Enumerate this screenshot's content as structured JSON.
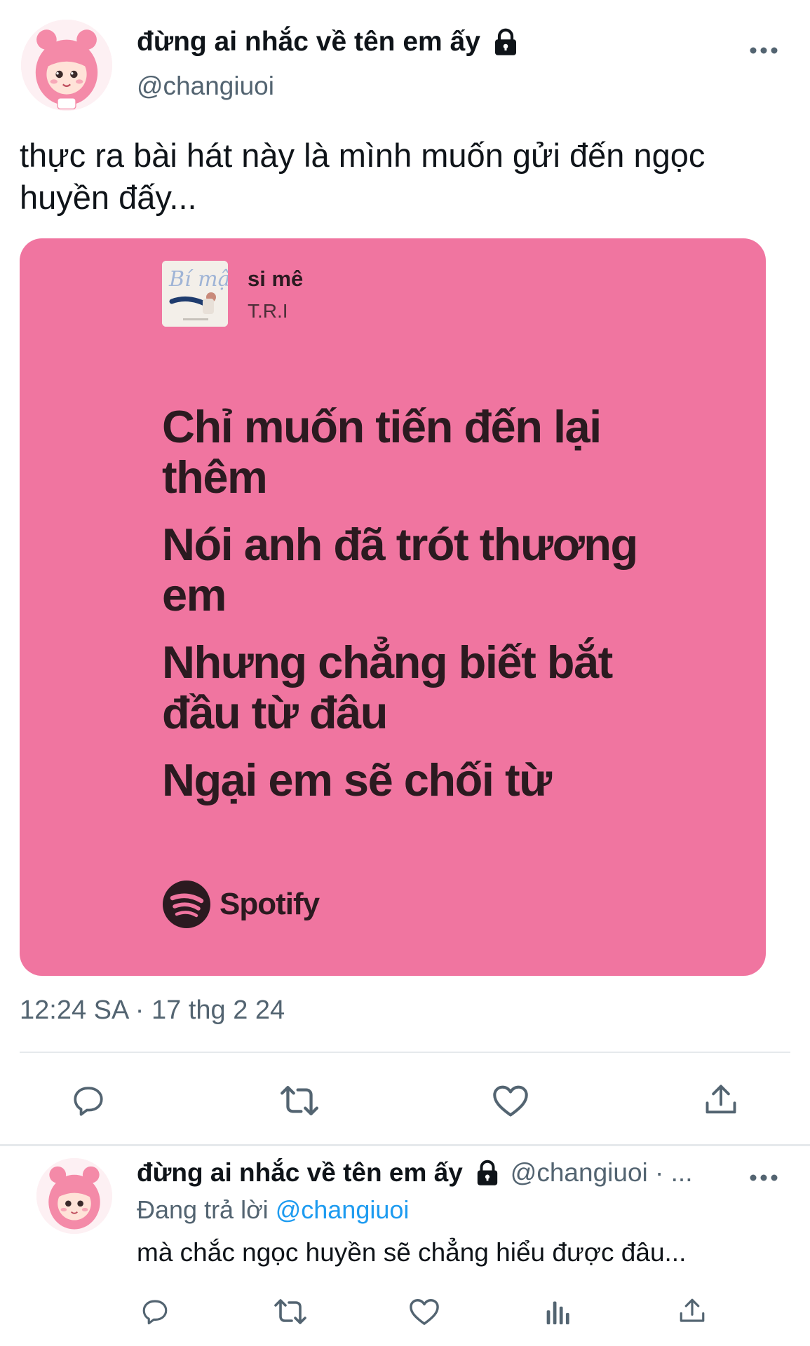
{
  "tweet": {
    "author_name": "đừng ai nhắc về tên em ấy",
    "handle": "@changiuoi",
    "text": "thực ra bài hát này là mình muốn gửi đến ngọc huyền đấy...",
    "timestamp": "12:24 SA · 17 thg 2 24"
  },
  "card": {
    "background": "#f075a0",
    "song_title": "si mê",
    "artist": "T.R.I",
    "lyrics": [
      "Chỉ muốn tiến đến lại thêm",
      "Nói anh đã trót thương em",
      "Nhưng chẳng biết bắt đầu từ đâu",
      "Ngại em sẽ chối từ"
    ],
    "brand": "Spotify"
  },
  "actions": {
    "icons": [
      "reply-icon",
      "retweet-icon",
      "like-icon",
      "share-icon"
    ],
    "reply_icons": [
      "reply-icon",
      "retweet-icon",
      "like-icon",
      "analytics-icon",
      "share-icon"
    ]
  },
  "reply": {
    "author_name": "đừng ai nhắc về tên em ấy",
    "handle": "@changiuoi · ...",
    "replying_prefix": "Đang trả lời",
    "replying_to": "@changiuoi",
    "text": "mà chắc ngọc huyền sẽ chẳng hiểu được đâu..."
  },
  "colors": {
    "text": "#0f1419",
    "secondary": "#536471",
    "link": "#1d9bf0",
    "card_pink": "#f075a0"
  }
}
